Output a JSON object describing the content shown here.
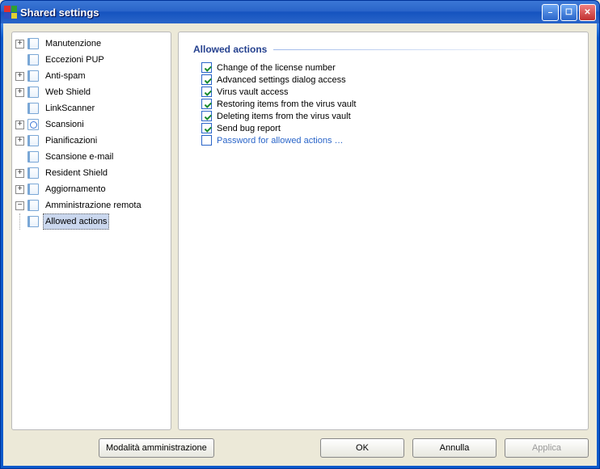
{
  "window": {
    "title": "Shared settings"
  },
  "tree": {
    "manutenzione": "Manutenzione",
    "eccezioni_pup": "Eccezioni PUP",
    "anti_spam": "Anti-spam",
    "web_shield": "Web Shield",
    "linkscanner": "LinkScanner",
    "scansioni": "Scansioni",
    "pianificazioni": "Pianificazioni",
    "scansione_email": "Scansione e-mail",
    "resident_shield": "Resident Shield",
    "aggiornamento": "Aggiornamento",
    "amministrazione_remota": "Amministrazione remota",
    "allowed_actions": "Allowed actions"
  },
  "content": {
    "section_title": "Allowed actions",
    "items": [
      {
        "label": "Change of the license number",
        "checked": true,
        "link": false
      },
      {
        "label": "Advanced settings dialog access",
        "checked": true,
        "link": false
      },
      {
        "label": "Virus vault access",
        "checked": true,
        "link": false
      },
      {
        "label": "Restoring items from the virus vault",
        "checked": true,
        "link": false
      },
      {
        "label": "Deleting items from the virus vault",
        "checked": true,
        "link": false
      },
      {
        "label": "Send bug report",
        "checked": true,
        "link": false
      },
      {
        "label": "Password for allowed actions …",
        "checked": false,
        "link": true
      }
    ]
  },
  "buttons": {
    "admin_mode": "Modalità amministrazione",
    "ok": "OK",
    "cancel": "Annulla",
    "apply": "Applica"
  }
}
